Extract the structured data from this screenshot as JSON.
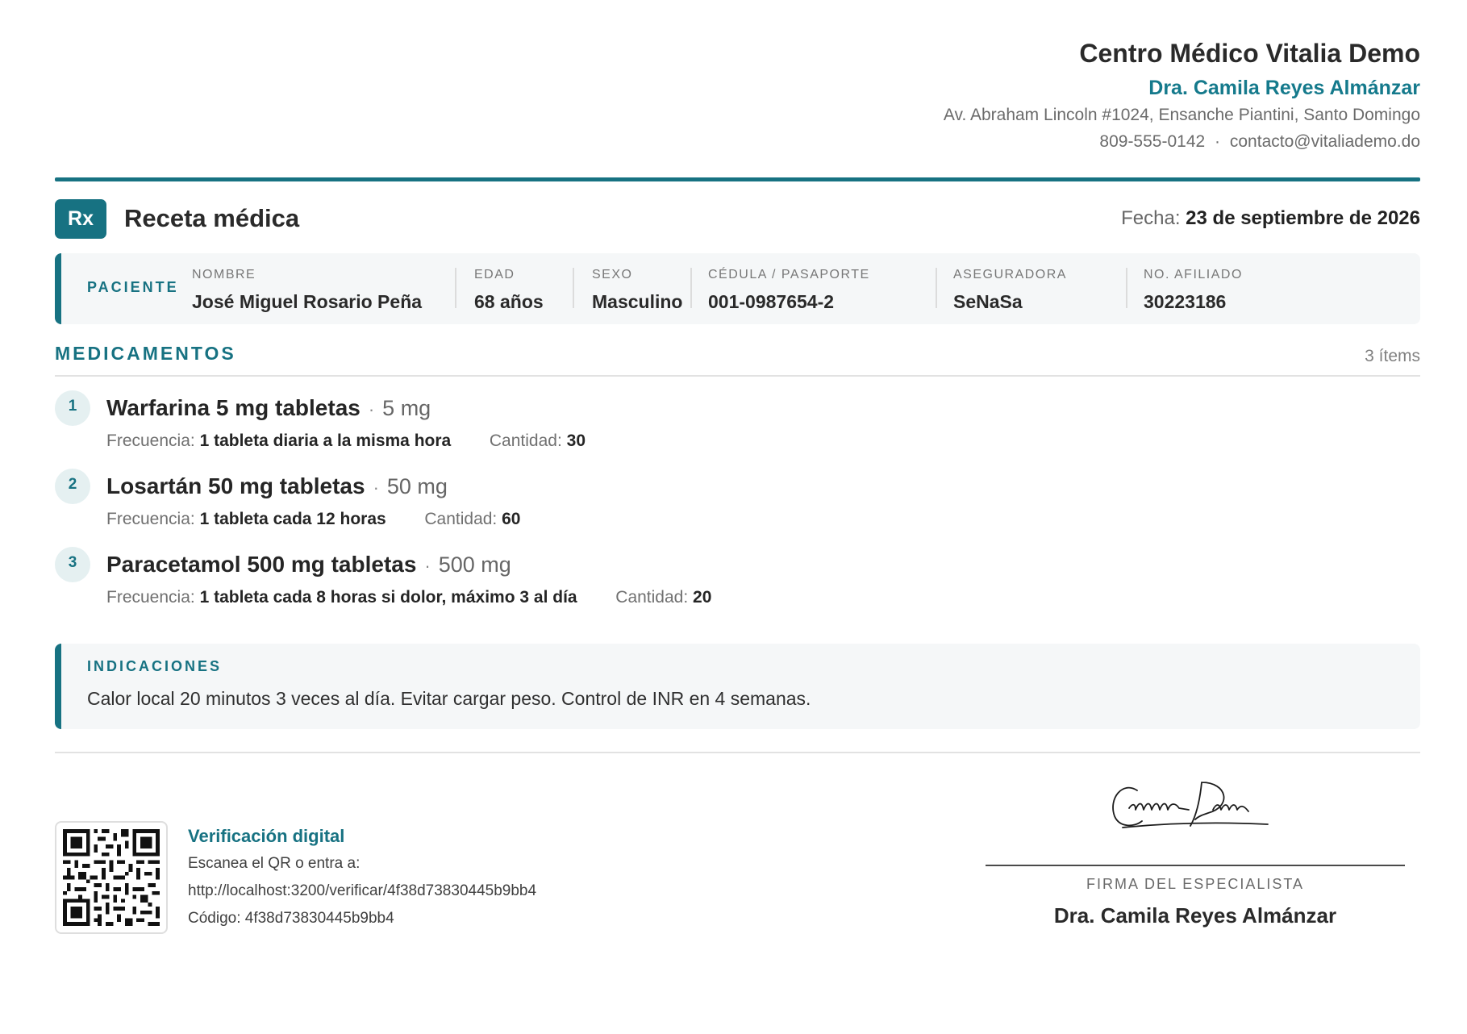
{
  "clinic": {
    "name": "Centro Médico Vitalia Demo",
    "doctor": "Dra. Camila Reyes Almánzar",
    "address": "Av. Abraham Lincoln #1024, Ensanche Piantini, Santo Domingo",
    "phone": "809-555-0142",
    "separator": "·",
    "email": "contacto@vitaliademo.do"
  },
  "document": {
    "badge": "Rx",
    "title": "Receta médica",
    "date_label": "Fecha:",
    "date_value": "23 de septiembre de 2026"
  },
  "patient": {
    "section_label": "PACIENTE",
    "fields": [
      {
        "label": "NOMBRE",
        "value": "José Miguel Rosario Peña"
      },
      {
        "label": "EDAD",
        "value": "68 años"
      },
      {
        "label": "SEXO",
        "value": "Masculino"
      },
      {
        "label": "CÉDULA / PASAPORTE",
        "value": "001-0987654-2"
      },
      {
        "label": "ASEGURADORA",
        "value": "SeNaSa"
      },
      {
        "label": "NO. AFILIADO",
        "value": "30223186"
      }
    ]
  },
  "medications": {
    "heading": "MEDICAMENTOS",
    "count": "3 ítems",
    "freq_label": "Frecuencia:",
    "qty_label": "Cantidad:",
    "items": [
      {
        "num": "1",
        "name": "Warfarina 5 mg tabletas",
        "dose": "5 mg",
        "frequency": "1 tableta diaria a la misma hora",
        "quantity": "30"
      },
      {
        "num": "2",
        "name": "Losartán 50 mg tabletas",
        "dose": "50 mg",
        "frequency": "1 tableta cada 12 horas",
        "quantity": "60"
      },
      {
        "num": "3",
        "name": "Paracetamol 500 mg tabletas",
        "dose": "500 mg",
        "frequency": "1 tableta cada 8 horas si dolor, máximo 3 al día",
        "quantity": "20"
      }
    ]
  },
  "indications": {
    "label": "INDICACIONES",
    "text": "Calor local 20 minutos 3 veces al día. Evitar cargar peso. Control de INR en 4 semanas."
  },
  "verification": {
    "title": "Verificación digital",
    "instruction": "Escanea el QR o entra a:",
    "url": "http://localhost:3200/verificar/4f38d73830445b9bb4",
    "code": "Código: 4f38d73830445b9bb4"
  },
  "signature": {
    "label": "FIRMA DEL ESPECIALISTA",
    "name": "Dra. Camila Reyes Almánzar"
  },
  "colors": {
    "accent": "#177282",
    "panel": "#f5f7f8"
  }
}
